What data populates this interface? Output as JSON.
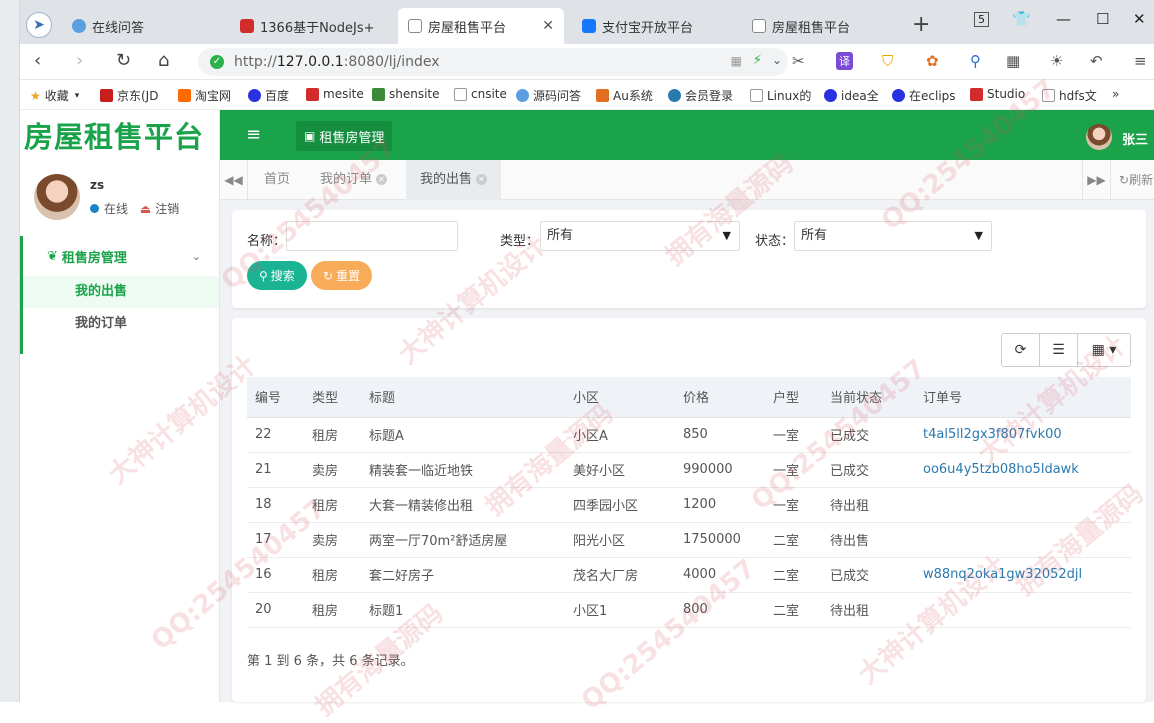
{
  "browser": {
    "tabs": [
      {
        "label": "在线问答",
        "color": "#5aa0e0"
      },
      {
        "label": "1366基于NodeJs+",
        "color": "#d22b2b"
      },
      {
        "label": "房屋租售平台",
        "color": "#888888"
      },
      {
        "label": "支付宝开放平台",
        "color": "#1677ff"
      },
      {
        "label": "房屋租售平台",
        "color": "#888888"
      }
    ],
    "url_prefix": "http://",
    "url_host": "127.0.0.1",
    "url_rest": ":8080/lj/index",
    "extensions": {
      "translate": "译",
      "badge": "5"
    },
    "bookmarks": [
      {
        "label": "收藏",
        "color": "#f0a020"
      },
      {
        "label": "京东(JD",
        "color": "#c81e1e"
      },
      {
        "label": "淘宝网",
        "color": "#ff6a00"
      },
      {
        "label": "百度",
        "color": "#2932e1"
      },
      {
        "label": "mesite",
        "color": "#d22b2b"
      },
      {
        "label": "shensite",
        "color": "#3a8a3a"
      },
      {
        "label": "cnsite",
        "color": "#999999"
      },
      {
        "label": "源码问答",
        "color": "#5aa0e0"
      },
      {
        "label": "Au系统",
        "color": "#e07020"
      },
      {
        "label": "会员登录",
        "color": "#2a7ab0"
      },
      {
        "label": "Linux的",
        "color": "#999999"
      },
      {
        "label": "idea全",
        "color": "#2932e1"
      },
      {
        "label": "在eclips",
        "color": "#2932e1"
      },
      {
        "label": "Studio",
        "color": "#d22b2b"
      },
      {
        "label": "hdfs文",
        "color": "#999999"
      },
      {
        "label": "»",
        "color": ""
      }
    ]
  },
  "app": {
    "logo": "房屋租售平台",
    "user": {
      "name": "zs",
      "status": "在线",
      "logout": "注销"
    },
    "menu": {
      "group": "租售房管理",
      "items": [
        "我的出售",
        "我的订单"
      ]
    },
    "topbar": {
      "module": "租售房管理",
      "username": "张三"
    },
    "page_tabs": [
      "首页",
      "我的订单",
      "我的出售"
    ],
    "refresh": "刷新",
    "search": {
      "name_label": "名称：",
      "name_value": "",
      "type_label": "类型：",
      "type_value": "所有",
      "status_label": "状态：",
      "status_value": "所有",
      "search_btn": "搜索",
      "reset_btn": "重置"
    },
    "table": {
      "columns": [
        "编号",
        "类型",
        "标题",
        "小区",
        "价格",
        "户型",
        "当前状态",
        "订单号"
      ],
      "rows": [
        [
          "22",
          "租房",
          "标题A",
          "小区A",
          "850",
          "一室",
          "已成交",
          "t4al5ll2gx3f807fvk00"
        ],
        [
          "21",
          "卖房",
          "精装套一临近地铁",
          "美好小区",
          "990000",
          "一室",
          "已成交",
          "oo6u4y5tzb08ho5ldawk"
        ],
        [
          "18",
          "租房",
          "大套一精装修出租",
          "四季园小区",
          "1200",
          "一室",
          "待出租",
          ""
        ],
        [
          "17",
          "卖房",
          "两室一厅70m²舒适房屋",
          "阳光小区",
          "1750000",
          "二室",
          "待出售",
          ""
        ],
        [
          "16",
          "租房",
          "套二好房子",
          "茂名大厂房",
          "4000",
          "二室",
          "已成交",
          "w88nq2oka1gw32052djl"
        ],
        [
          "20",
          "租房",
          "标题1",
          "小区1",
          "800",
          "二室",
          "待出租",
          ""
        ]
      ]
    },
    "pager": "第 1 到 6 条，共 6 条记录。"
  },
  "watermarks": [
    "QQ:254540457",
    "大神计算机设计",
    "拥有海量源码"
  ]
}
